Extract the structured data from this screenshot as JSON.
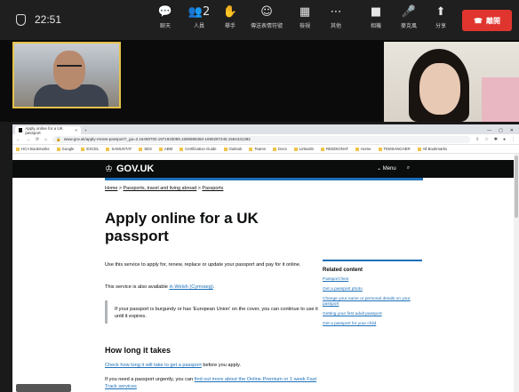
{
  "meeting": {
    "time": "22:51",
    "tools": [
      {
        "icon": "chat",
        "glyph": "💬",
        "label": "聊天"
      },
      {
        "icon": "people",
        "glyph": "👥2",
        "label": "人員"
      },
      {
        "icon": "hand",
        "glyph": "✋",
        "label": "舉手"
      },
      {
        "icon": "emoji",
        "glyph": "☺",
        "label": "傳送表情符號"
      },
      {
        "icon": "view",
        "glyph": "▦",
        "label": "檢視"
      },
      {
        "icon": "more",
        "glyph": "⋯",
        "label": "其他"
      },
      {
        "icon": "camera",
        "glyph": "■",
        "label": "相機"
      },
      {
        "icon": "mic",
        "glyph": "🎤",
        "label": "麥克風"
      },
      {
        "icon": "share",
        "glyph": "⬆",
        "label": "分享"
      }
    ],
    "leave_label": "離開",
    "leave_color": "#e0352f"
  },
  "browser": {
    "tab_title": "Apply online for a UK passport",
    "new_tab": "+",
    "url": "www.gov.uk/apply-renew-passport?_ga=2.16490700.1971933089.1595985360-1690297245.1594431382",
    "bookmarks": [
      "HCA Bookmarks",
      "Google",
      "EXCEL",
      "SAMUSTAT",
      "SES",
      "ABM",
      "Certification Guide",
      "Outlook",
      "Teams",
      "Docs",
      "LinkedIn",
      "REDDIONAT",
      "Home",
      "TEMSANCHER",
      "All Bookmarks"
    ]
  },
  "gov": {
    "logo": "GOV.UK",
    "menu_label": "Menu",
    "breadcrumbs": [
      "Home",
      "Passports, travel and living abroad",
      "Passports"
    ],
    "title": "Apply online for a UK passport",
    "intro": "Use this service to apply for, renew, replace or update your passport and pay for it online.",
    "welsh_prefix": "This service is also available ",
    "welsh_link": "in Welsh (Cymraeg)",
    "inset": "If your passport is burgundy or has 'European Union' on the cover, you can continue to use it until it expires.",
    "section_title": "How long it takes",
    "check_link": "Check how long it will take to get a passport",
    "check_suffix": " before you apply.",
    "urgent_prefix": "If you need a passport urgently, you can ",
    "urgent_link": "find out more about the Online Premium or 1 week Fast Track services",
    "related_title": "Related content",
    "related": [
      "Passport fees",
      "Get a passport photo",
      "Change your name or personal details on your passport",
      "Getting your first adult passport",
      "Get a passport for your child"
    ],
    "accent": "#1d70b8"
  }
}
